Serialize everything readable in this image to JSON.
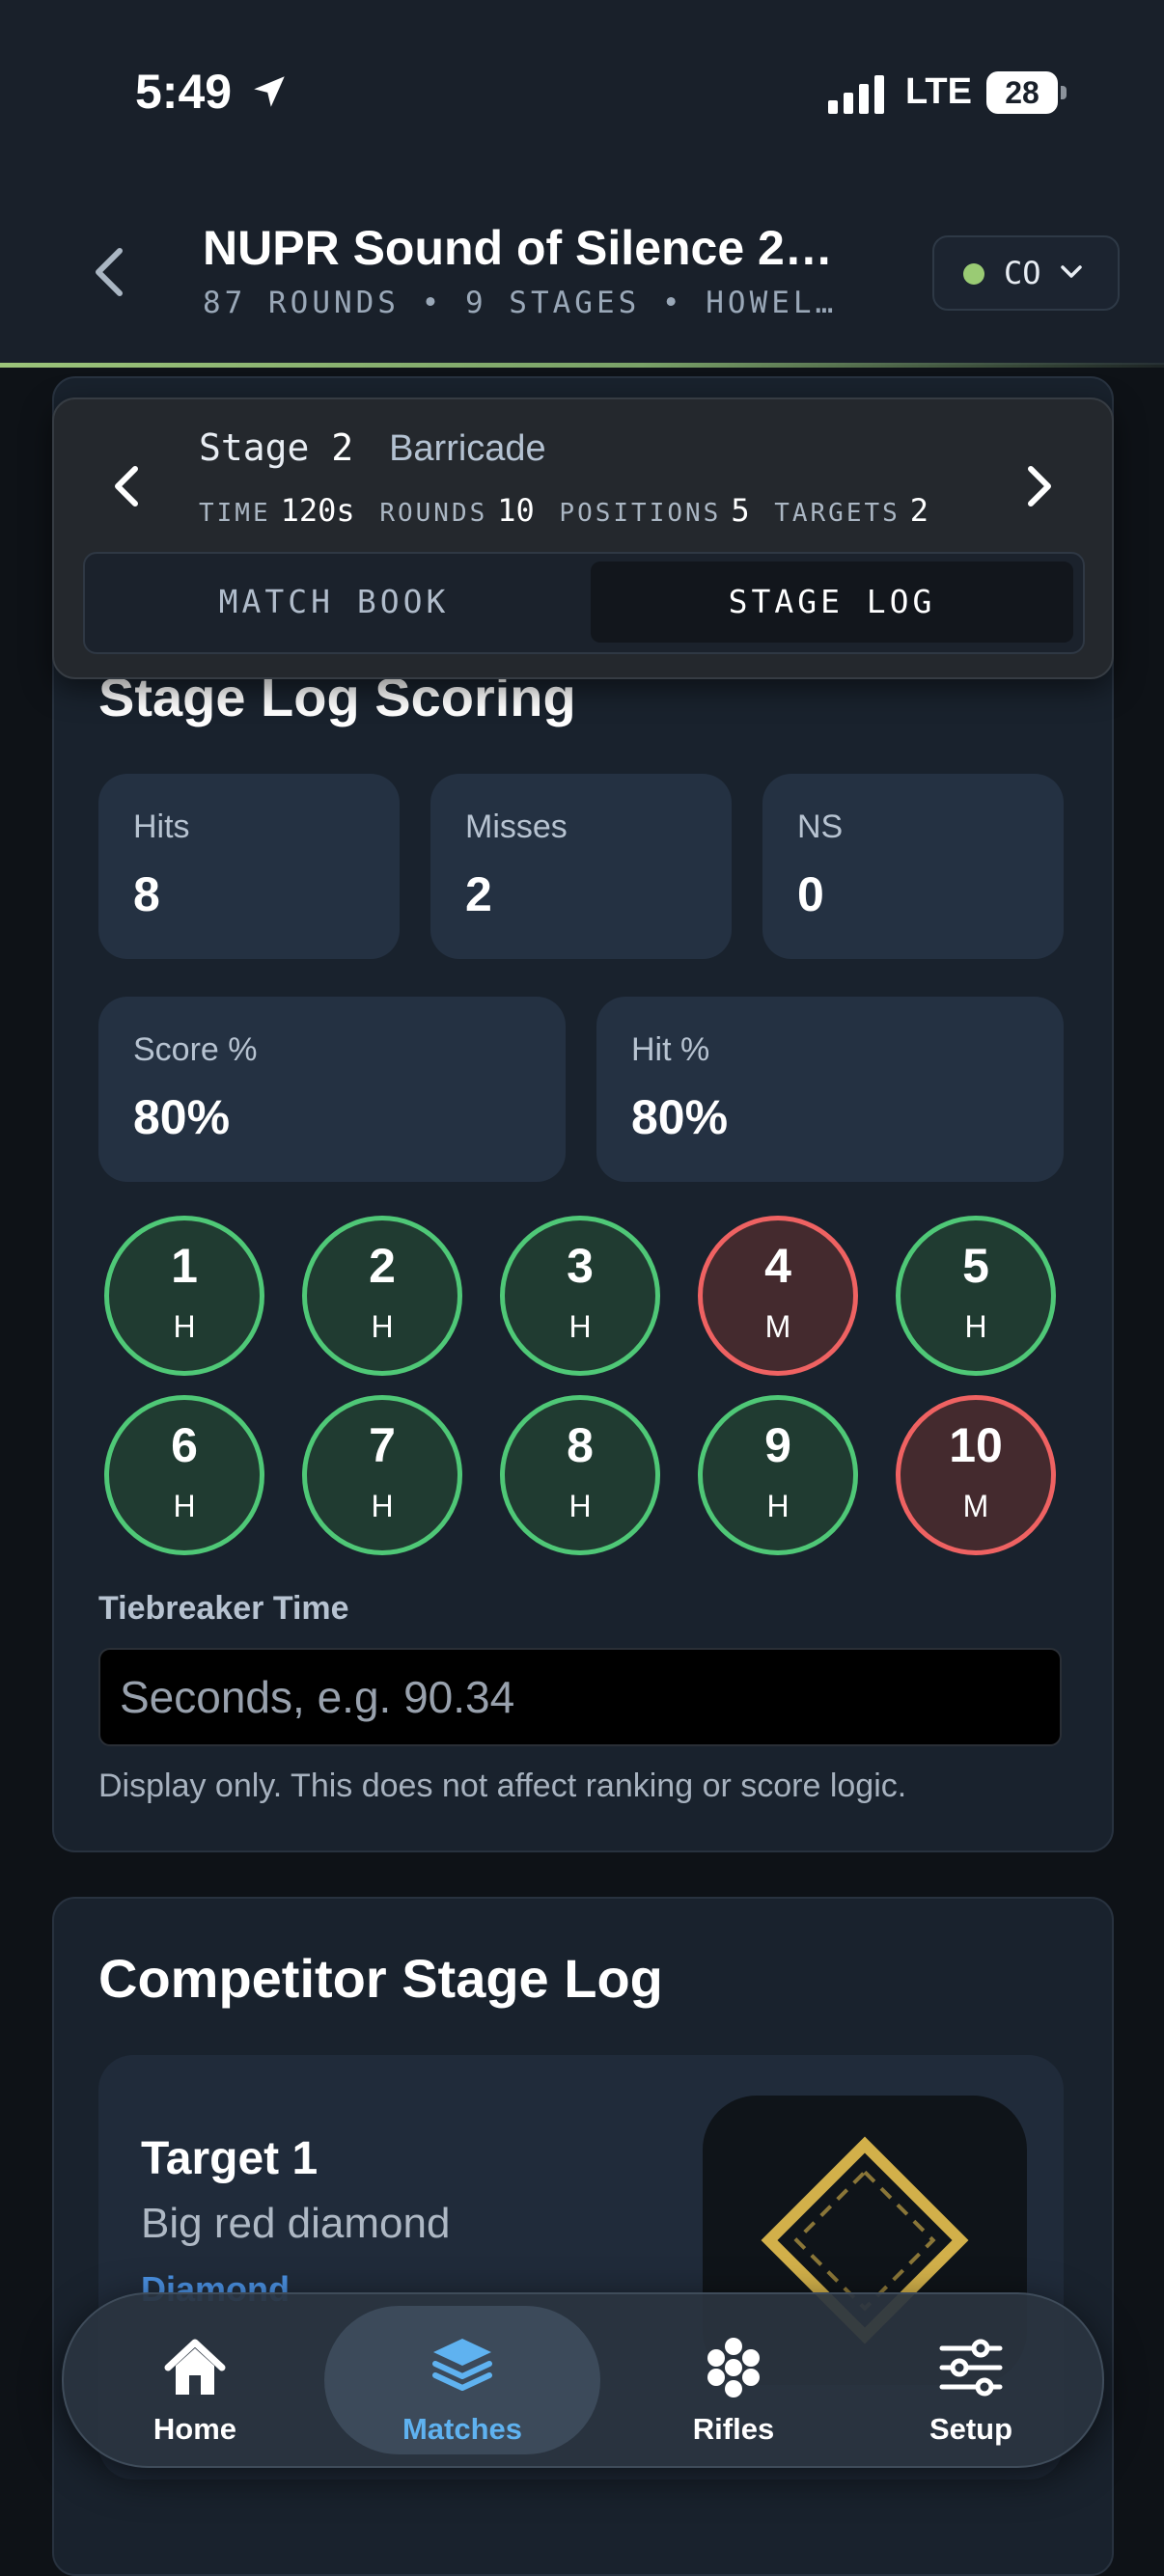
{
  "status_bar": {
    "time": "5:49",
    "network": "LTE",
    "battery": "28"
  },
  "header": {
    "title": "NUPR Sound of Silence 2…",
    "subtitle": "87 ROUNDS • 9 STAGES • HOWEL…",
    "division": "CO",
    "division_dot_color": "#9acb74"
  },
  "stage": {
    "label": "Stage",
    "number": "2",
    "name": "Barricade",
    "time_label": "TIME",
    "time_value": "120s",
    "rounds_label": "ROUNDS",
    "rounds_value": "10",
    "positions_label": "POSITIONS",
    "positions_value": "5",
    "targets_label": "TARGETS",
    "targets_value": "2",
    "tabs": {
      "match_book": "MATCH BOOK",
      "stage_log": "STAGE LOG",
      "active": "stage_log"
    }
  },
  "scoring": {
    "title": "Stage Log Scoring",
    "hits_label": "Hits",
    "hits_value": "8",
    "misses_label": "Misses",
    "misses_value": "2",
    "ns_label": "NS",
    "ns_value": "0",
    "score_label": "Score %",
    "score_value": "80%",
    "hit_label": "Hit %",
    "hit_value": "80%",
    "shots": [
      {
        "n": "1",
        "r": "H"
      },
      {
        "n": "2",
        "r": "H"
      },
      {
        "n": "3",
        "r": "H"
      },
      {
        "n": "4",
        "r": "M"
      },
      {
        "n": "5",
        "r": "H"
      },
      {
        "n": "6",
        "r": "H"
      },
      {
        "n": "7",
        "r": "H"
      },
      {
        "n": "8",
        "r": "H"
      },
      {
        "n": "9",
        "r": "H"
      },
      {
        "n": "10",
        "r": "M"
      }
    ],
    "hit_color": "#4fc877",
    "miss_color": "#ef6262",
    "tiebreaker_label": "Tiebreaker Time",
    "tiebreaker_placeholder": "Seconds, e.g. 90.34",
    "tiebreaker_value": "",
    "note": "Display only. This does not affect ranking or score logic."
  },
  "log": {
    "title": "Competitor Stage Log",
    "target_title": "Target 1",
    "target_desc": "Big red diamond",
    "target_type": "Diamond"
  },
  "tabbar": {
    "home": "Home",
    "matches": "Matches",
    "rifles": "Rifles",
    "setup": "Setup",
    "active": "matches",
    "active_color": "#5fb2f0"
  }
}
